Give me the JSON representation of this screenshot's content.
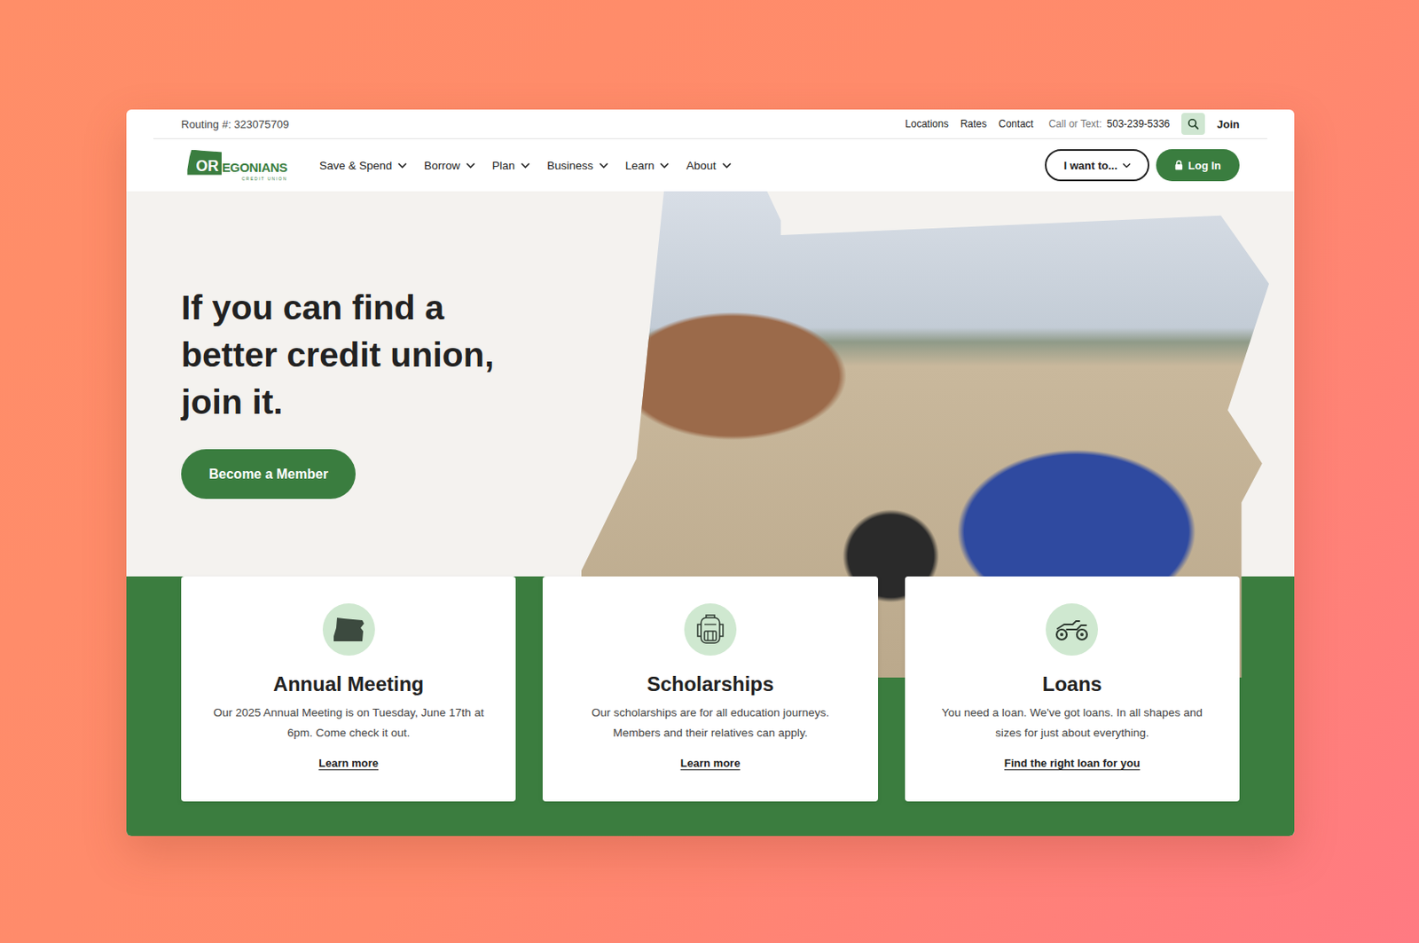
{
  "top_bar": {
    "routing": "Routing #: 323075709",
    "links": [
      "Locations",
      "Rates",
      "Contact"
    ],
    "phone_label": "Call or Text:",
    "phone": "503-239-5336",
    "join": "Join"
  },
  "logo": {
    "mark": "OR",
    "rest": "EGONIANS",
    "sub": "CREDIT UNION"
  },
  "nav": [
    "Save & Spend",
    "Borrow",
    "Plan",
    "Business",
    "Learn",
    "About"
  ],
  "actions": {
    "menu": "I want to...",
    "login": "Log In"
  },
  "hero": {
    "headline_lines": [
      "If you can find a",
      "better credit union,",
      "join it."
    ],
    "cta": "Become a Member"
  },
  "cards": [
    {
      "kind": "oregon",
      "title": "Annual Meeting",
      "text": "Our 2025 Annual Meeting is on Tuesday, June 17th at 6pm. Come check it out.",
      "link": "Learn more"
    },
    {
      "kind": "backpack",
      "title": "Scholarships",
      "text": "Our scholarships are for all education journeys. Members and their relatives can apply.",
      "link": "Learn more"
    },
    {
      "kind": "atv",
      "title": "Loans",
      "text": "You need a loan. We've got loans. In all shapes and sizes for just about everything.",
      "link": "Find the right loan for you"
    }
  ]
}
